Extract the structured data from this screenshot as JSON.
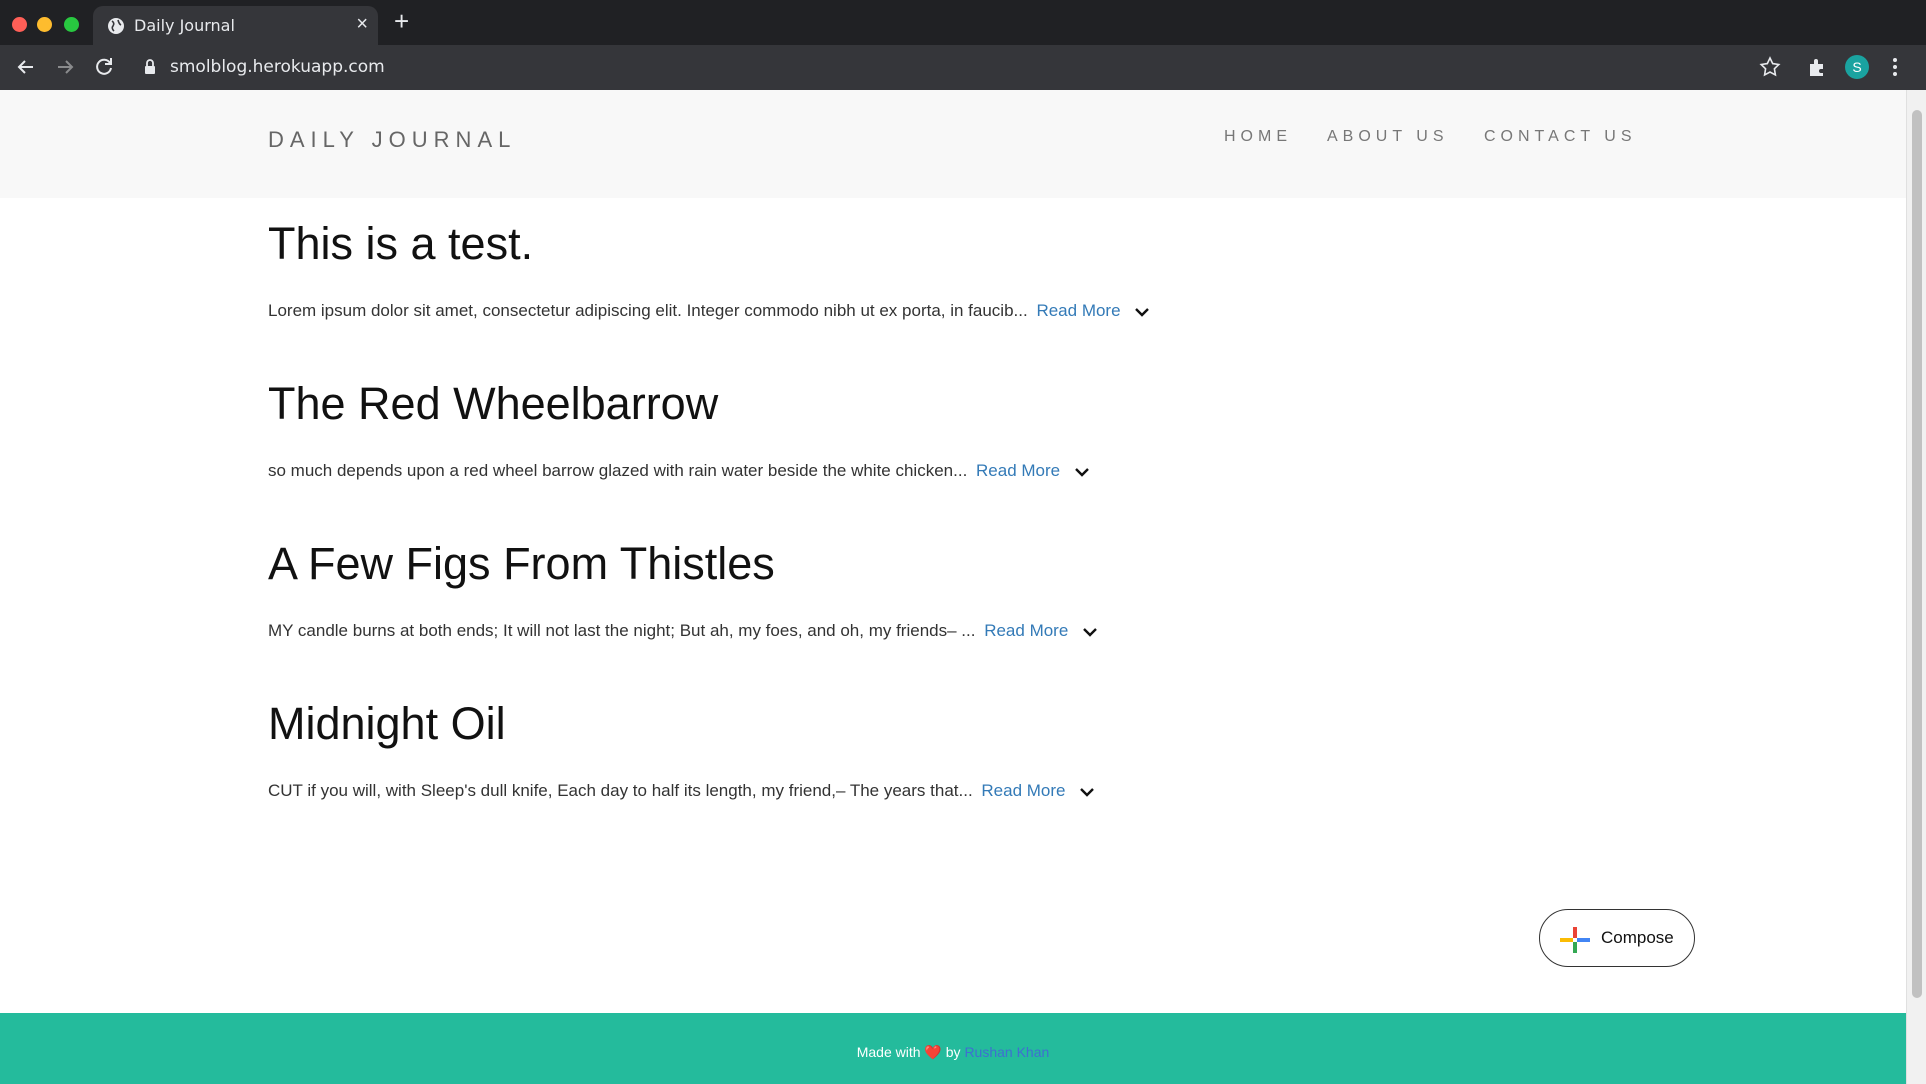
{
  "browser": {
    "tab_title": "Daily Journal",
    "new_tab_label": "+",
    "close_label": "×",
    "url": "smolblog.herokuapp.com",
    "avatar_initial": "S"
  },
  "header": {
    "brand": "DAILY JOURNAL",
    "nav": [
      "HOME",
      "ABOUT US",
      "CONTACT US"
    ]
  },
  "posts": [
    {
      "title": "This is a test.",
      "excerpt": "Lorem ipsum dolor sit amet, consectetur adipiscing elit. Integer commodo nibh ut ex porta, in faucib...",
      "more": "Read More"
    },
    {
      "title": "The Red Wheelbarrow",
      "excerpt": "so much depends upon a red wheel barrow glazed with rain water beside the white chicken...",
      "more": "Read More"
    },
    {
      "title": "A Few Figs From Thistles",
      "excerpt": "MY candle burns at both ends; It will not last the night; But ah, my foes, and oh, my friends– ...",
      "more": "Read More"
    },
    {
      "title": "Midnight Oil",
      "excerpt": "CUT if you will, with Sleep's dull knife, Each day to half its length, my friend,– The years that...",
      "more": "Read More"
    }
  ],
  "compose": {
    "label": "Compose"
  },
  "footer": {
    "made_with": "Made with",
    "heart": "❤️",
    "by": "by",
    "author": "Rushan Khan"
  },
  "colors": {
    "footer_bg": "#24bb9c",
    "link": "#337ab7",
    "header_bg": "#f8f8f8"
  }
}
